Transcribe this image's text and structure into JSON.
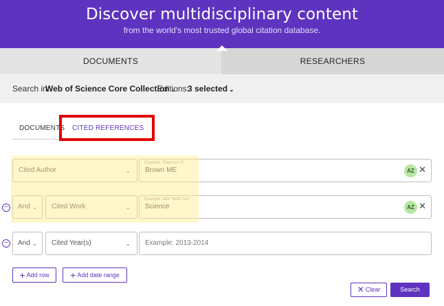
{
  "hero": {
    "title": "Discover multidisciplinary content",
    "subtitle": "from the world's most trusted global citation database."
  },
  "main_tabs": [
    {
      "label": "DOCUMENTS"
    },
    {
      "label": "RESEARCHERS"
    }
  ],
  "search_in": {
    "label": "Search in:",
    "collection": "Web of Science Core Collection",
    "editions_label": "Editions:",
    "editions_value": "3 selected"
  },
  "sub_tabs": [
    {
      "label": "DOCUMENTS"
    },
    {
      "label": "CITED REFERENCES"
    }
  ],
  "rows": [
    {
      "field": "Cited Author",
      "hint": "Example: Peterson S*",
      "value": "Brown ME",
      "az": "AZ"
    },
    {
      "operator": "And",
      "field": "Cited Work",
      "hint": "Example: adv* food* res*",
      "value": "Science",
      "az": "AZ"
    },
    {
      "operator": "And",
      "field": "Cited Year(s)",
      "placeholder": "Example: 2013-2014"
    }
  ],
  "buttons": {
    "add_row": "Add row",
    "add_date_range": "Add date range",
    "clear": "Clear",
    "search": "Search"
  },
  "colors": {
    "brand": "#5e33bf",
    "highlight_outline": "#e00000",
    "az_badge": "#b6e7a4"
  }
}
